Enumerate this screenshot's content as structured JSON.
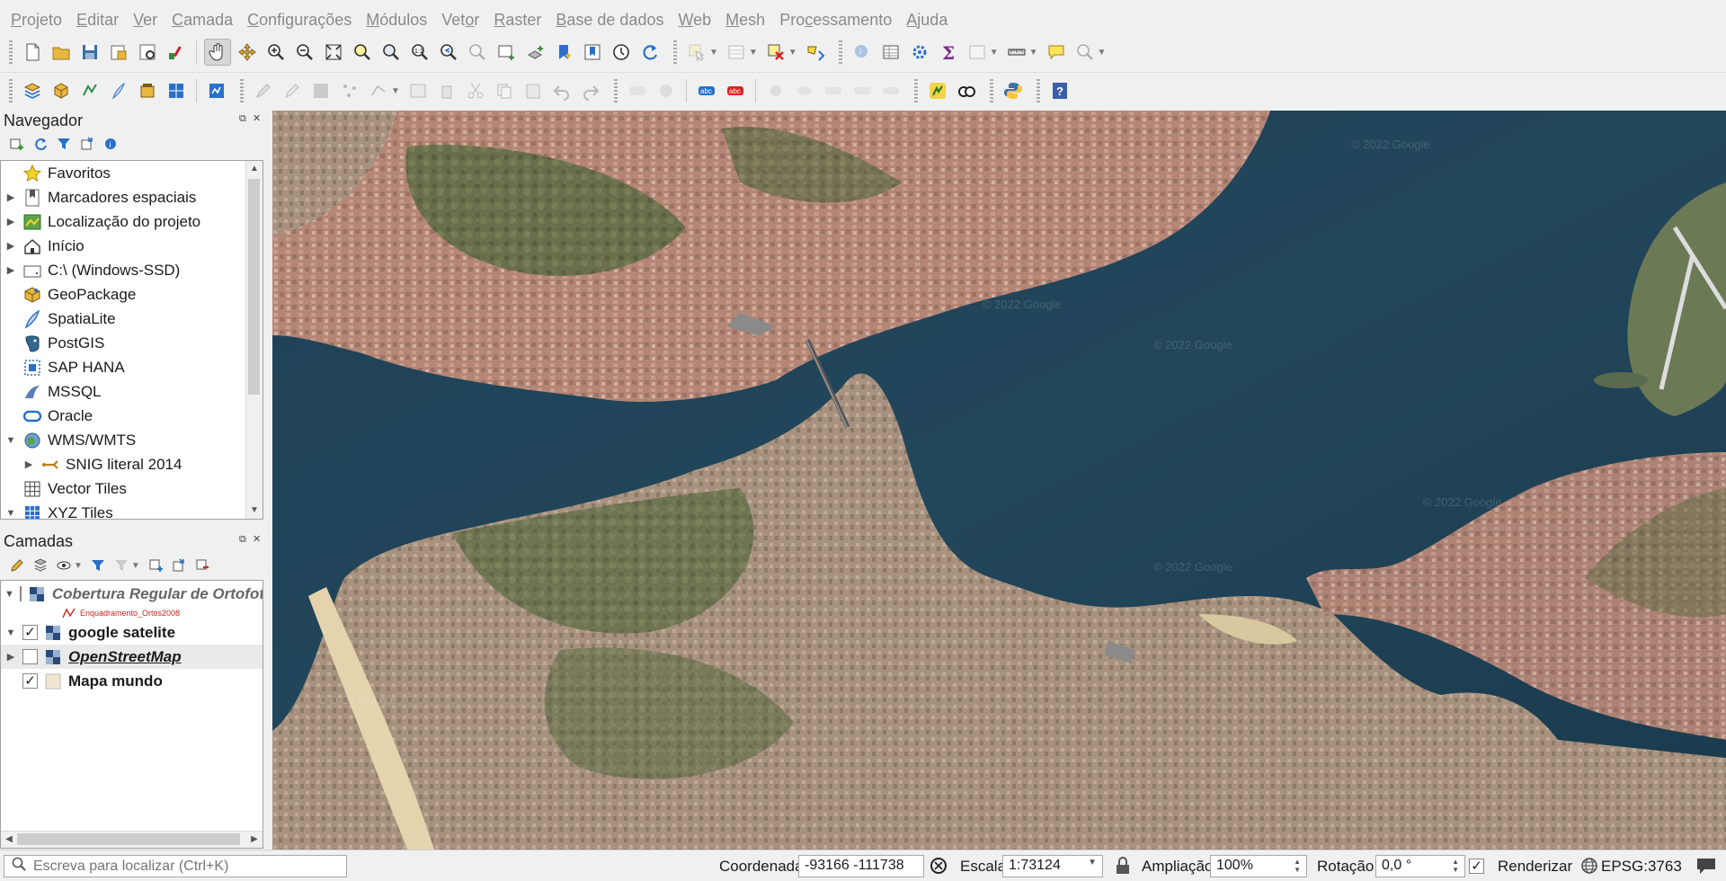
{
  "menu": [
    {
      "pre": "",
      "ul": "P",
      "post": "rojeto"
    },
    {
      "pre": "",
      "ul": "E",
      "post": "ditar"
    },
    {
      "pre": "",
      "ul": "V",
      "post": "er"
    },
    {
      "pre": "",
      "ul": "C",
      "post": "amada"
    },
    {
      "pre": "",
      "ul": "C",
      "post": "onfigurações"
    },
    {
      "pre": "",
      "ul": "M",
      "post": "ódulos"
    },
    {
      "pre": "Vet",
      "ul": "o",
      "post": "r"
    },
    {
      "pre": "",
      "ul": "R",
      "post": "aster"
    },
    {
      "pre": "",
      "ul": "B",
      "post": "ase de dados"
    },
    {
      "pre": "",
      "ul": "W",
      "post": "eb"
    },
    {
      "pre": "",
      "ul": "M",
      "post": "esh"
    },
    {
      "pre": "Pro",
      "ul": "c",
      "post": "essamento"
    },
    {
      "pre": "",
      "ul": "A",
      "post": "juda"
    }
  ],
  "navigator": {
    "title": "Navegador",
    "items": [
      {
        "label": "Favoritos",
        "icon": "star-icon",
        "expander": ""
      },
      {
        "label": "Marcadores espaciais",
        "icon": "bookmark-icon",
        "expander": "▶"
      },
      {
        "label": "Localização do projeto",
        "icon": "project-home-icon",
        "expander": "▶"
      },
      {
        "label": "Início",
        "icon": "home-icon",
        "expander": "▶"
      },
      {
        "label": "C:\\ (Windows-SSD)",
        "icon": "drive-icon",
        "expander": "▶"
      },
      {
        "label": "GeoPackage",
        "icon": "geopackage-icon",
        "expander": ""
      },
      {
        "label": "SpatiaLite",
        "icon": "spatialite-icon",
        "expander": ""
      },
      {
        "label": "PostGIS",
        "icon": "postgis-icon",
        "expander": ""
      },
      {
        "label": "SAP HANA",
        "icon": "sap-hana-icon",
        "expander": ""
      },
      {
        "label": "MSSQL",
        "icon": "mssql-icon",
        "expander": ""
      },
      {
        "label": "Oracle",
        "icon": "oracle-icon",
        "expander": ""
      },
      {
        "label": "WMS/WMTS",
        "icon": "wms-icon",
        "expander": "▼"
      },
      {
        "label": "SNIG literal 2014",
        "icon": "wms-connection-icon",
        "expander": "▶",
        "indent": true
      },
      {
        "label": "Vector Tiles",
        "icon": "vector-tiles-icon",
        "expander": ""
      },
      {
        "label": "XYZ Tiles",
        "icon": "xyz-tiles-icon",
        "expander": "▼"
      }
    ]
  },
  "layers": {
    "title": "Camadas",
    "items": [
      {
        "label": "Cobertura Regular de Ortofotos",
        "checked": "",
        "expander": "▼",
        "style": "italic-gray"
      },
      {
        "label": "Enquadramento_Ortos2008",
        "sublegend": true
      },
      {
        "label": "google satelite",
        "checked": "✓",
        "expander": "▼",
        "style": "bold"
      },
      {
        "label": "OpenStreetMap",
        "checked": "",
        "expander": "▶",
        "style": "italic-underline"
      },
      {
        "label": "Mapa mundo",
        "checked": "✓",
        "expander": "",
        "style": "bold"
      }
    ]
  },
  "map": {
    "watermarks": [
      "© 2022 Google",
      "© 2022 Google",
      "© 2022 Google",
      "© 2022 Google",
      "© 2022 Google",
      "© 2022 Google"
    ]
  },
  "status": {
    "search_placeholder": "Escreva para localizar (Ctrl+K)",
    "coord_label": "Coordenada",
    "coord_value": "-93166 -111738",
    "scale_label": "Escala",
    "scale_value": "1:73124",
    "magnifier_label": "Ampliação",
    "magnifier_value": "100%",
    "rotation_label": "Rotação",
    "rotation_value": "0,0 °",
    "render_label": "Renderizar",
    "render_checked": "✓",
    "crs": "EPSG:3763"
  },
  "colors": {
    "water": "#1f3f52",
    "urban": "#b98a7a",
    "vegetation": "#4f5d38",
    "accent": "#0078d7"
  }
}
